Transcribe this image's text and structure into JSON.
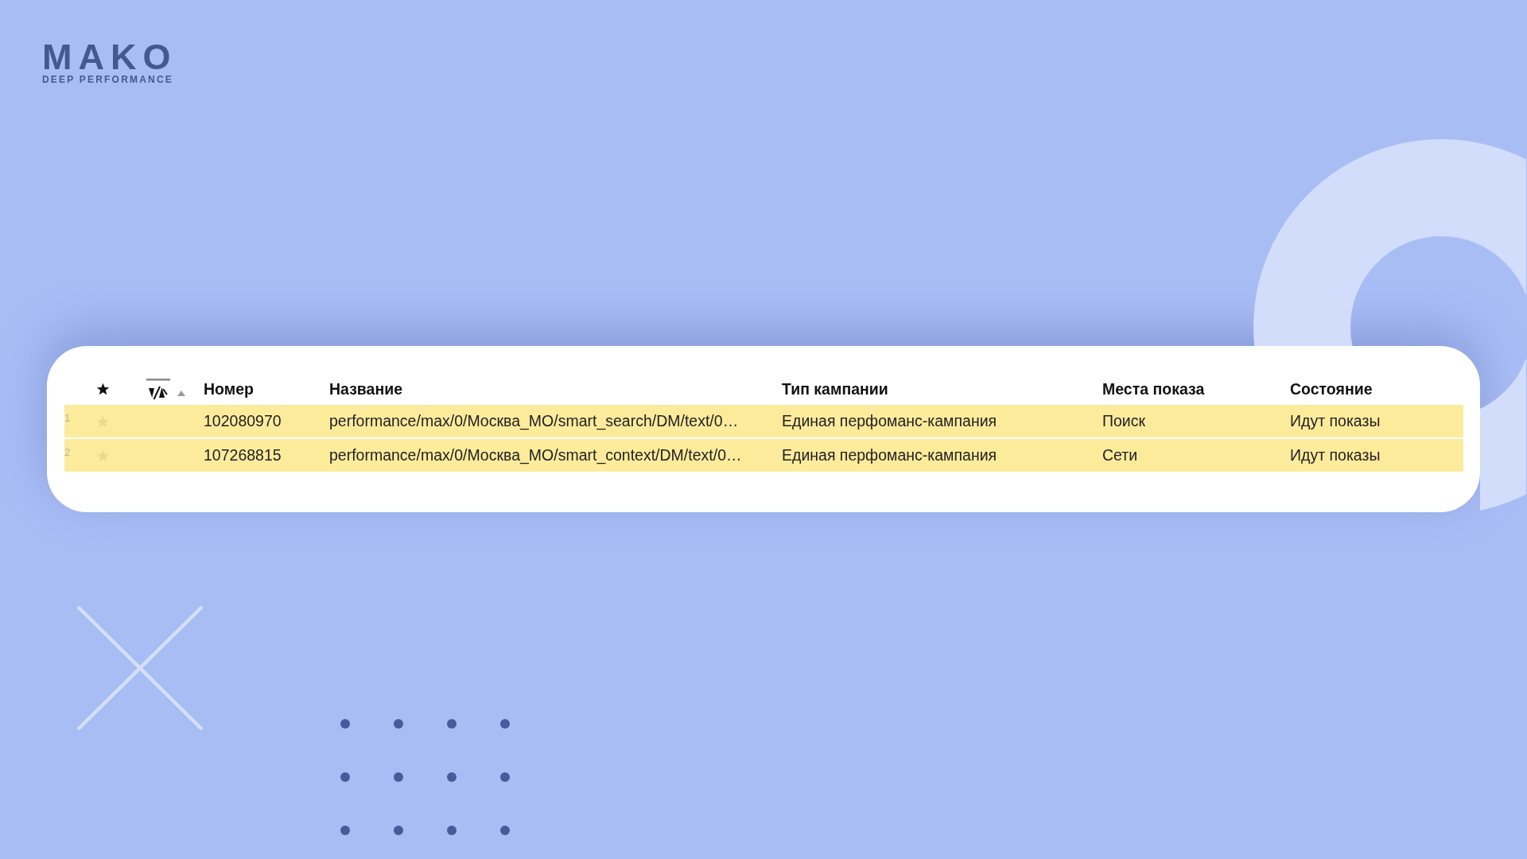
{
  "logo": {
    "wordmark": "MAKO",
    "tagline": "DEEP PERFORMANCE"
  },
  "table": {
    "columns": [
      "Номер",
      "Название",
      "Тип кампании",
      "Места показа",
      "Состояние"
    ],
    "rows": [
      {
        "number": "1",
        "starred": false,
        "selected": true,
        "cells": [
          "102080970",
          "performance/max/0/Москва_МО/smart_search/DM/text/0…",
          "Единая перфоманс-кампания",
          "Поиск",
          "Идут показы"
        ]
      },
      {
        "number": "2",
        "starred": false,
        "selected": true,
        "cells": [
          "107268815",
          "performance/max/0/Москва_МО/smart_context/DM/text/0…",
          "Единая перфоманс-кампания",
          "Сети",
          "Идут показы"
        ]
      }
    ]
  }
}
